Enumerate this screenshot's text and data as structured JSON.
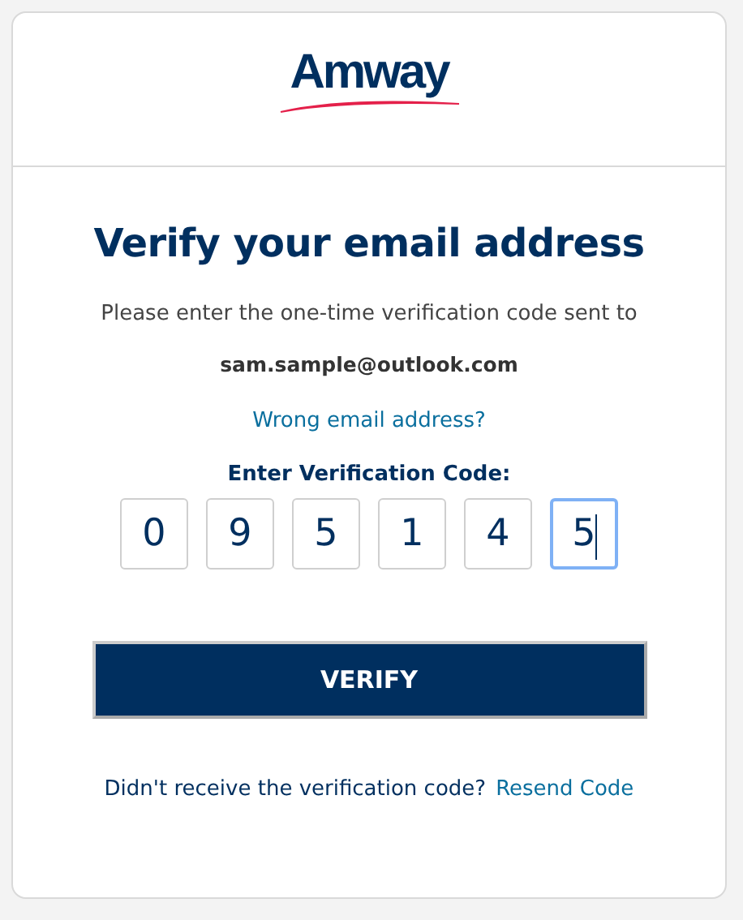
{
  "logo": {
    "text": "Amway"
  },
  "title": "Verify your email address",
  "instruction": "Please enter the one-time verification code sent to",
  "email": "sam.sample@outlook.com",
  "wrong_email_link": "Wrong email address?",
  "code_label": "Enter Verification Code:",
  "code_digits": [
    {
      "value": "0",
      "focused": false
    },
    {
      "value": "9",
      "focused": false
    },
    {
      "value": "5",
      "focused": false
    },
    {
      "value": "1",
      "focused": false
    },
    {
      "value": "4",
      "focused": false
    },
    {
      "value": "5",
      "focused": true
    }
  ],
  "verify_button": "VERIFY",
  "resend_prompt": "Didn't receive the verification code?",
  "resend_link": "Resend Code"
}
